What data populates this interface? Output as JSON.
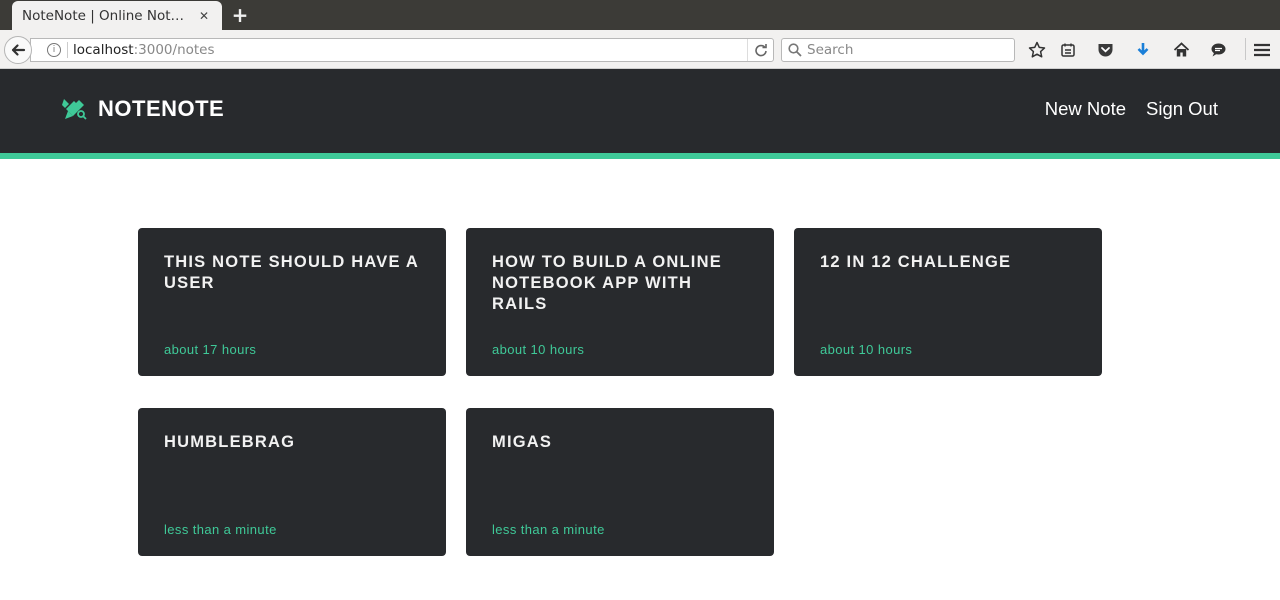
{
  "browser": {
    "tab_title": "NoteNote | Online Not…",
    "url_host": "localhost",
    "url_rest": ":3000/notes",
    "search_placeholder": "Search"
  },
  "app": {
    "brand": "NOTENOTE",
    "nav": {
      "new_note": "New Note",
      "sign_out": "Sign Out"
    },
    "accent_color": "#3fc998"
  },
  "notes": [
    {
      "title": "THIS NOTE SHOULD HAVE A USER",
      "time": "about 17 hours"
    },
    {
      "title": "HOW TO BUILD A ONLINE NOTEBOOK APP WITH RAILS",
      "time": "about 10 hours"
    },
    {
      "title": "12 IN 12 CHALLENGE",
      "time": "about 10 hours"
    },
    {
      "title": "HUMBLEBRAG",
      "time": "less than a minute"
    },
    {
      "title": "MIGAS",
      "time": "less than a minute"
    }
  ]
}
